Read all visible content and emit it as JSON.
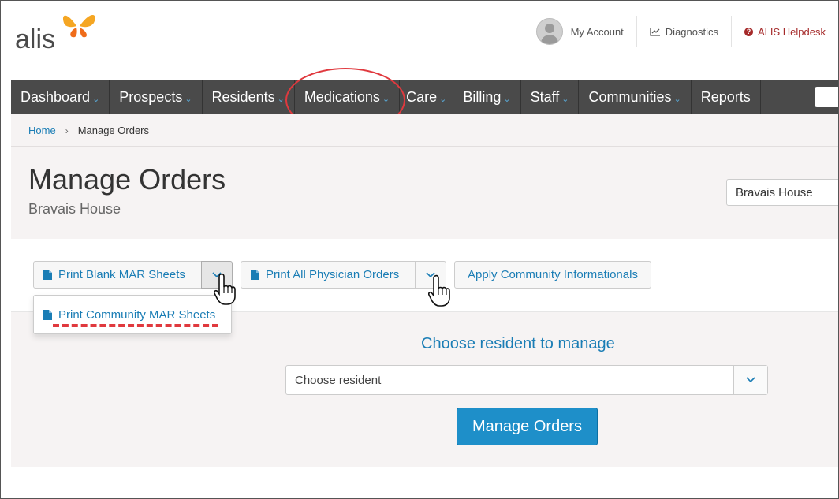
{
  "header": {
    "logo_text": "alis",
    "my_account": "My Account",
    "diagnostics": "Diagnostics",
    "helpdesk": "ALIS Helpdesk",
    "helpdesk_icon_glyph": "?"
  },
  "nav": {
    "items": [
      {
        "label": "Dashboard",
        "has_menu": true
      },
      {
        "label": "Prospects",
        "has_menu": true
      },
      {
        "label": "Residents",
        "has_menu": true
      },
      {
        "label": "Medications",
        "has_menu": true
      },
      {
        "label": "Care",
        "has_menu": true
      },
      {
        "label": "Billing",
        "has_menu": true
      },
      {
        "label": "Staff",
        "has_menu": true
      },
      {
        "label": "Communities",
        "has_menu": true
      },
      {
        "label": "Reports",
        "has_menu": false
      }
    ],
    "highlighted_item": "Medications"
  },
  "breadcrumb": {
    "home": "Home",
    "current": "Manage Orders"
  },
  "page": {
    "title": "Manage Orders",
    "subtitle": "Bravais House",
    "community_select_value": "Bravais House"
  },
  "actions": {
    "print_blank_mar": "Print Blank MAR Sheets",
    "print_all_physician_orders": "Print All Physician Orders",
    "apply_community_informationals": "Apply Community Informationals",
    "dropdown_item": "Print Community MAR Sheets"
  },
  "resident": {
    "heading": "Choose resident to manage",
    "select_placeholder": "Choose resident",
    "manage_button": "Manage Orders"
  },
  "colors": {
    "link_blue": "#1a7db5",
    "nav_bg": "#4a4a4a",
    "primary_button": "#1e8fc9",
    "annotation_red": "#e0393e",
    "helpdesk_red": "#a52a2a",
    "logo_orange": "#f5a623"
  },
  "icons": [
    "butterfly-logo-icon",
    "avatar-icon",
    "chart-line-icon",
    "question-circle-icon",
    "document-icon",
    "chevron-down-icon",
    "pointer-hand-icon"
  ]
}
